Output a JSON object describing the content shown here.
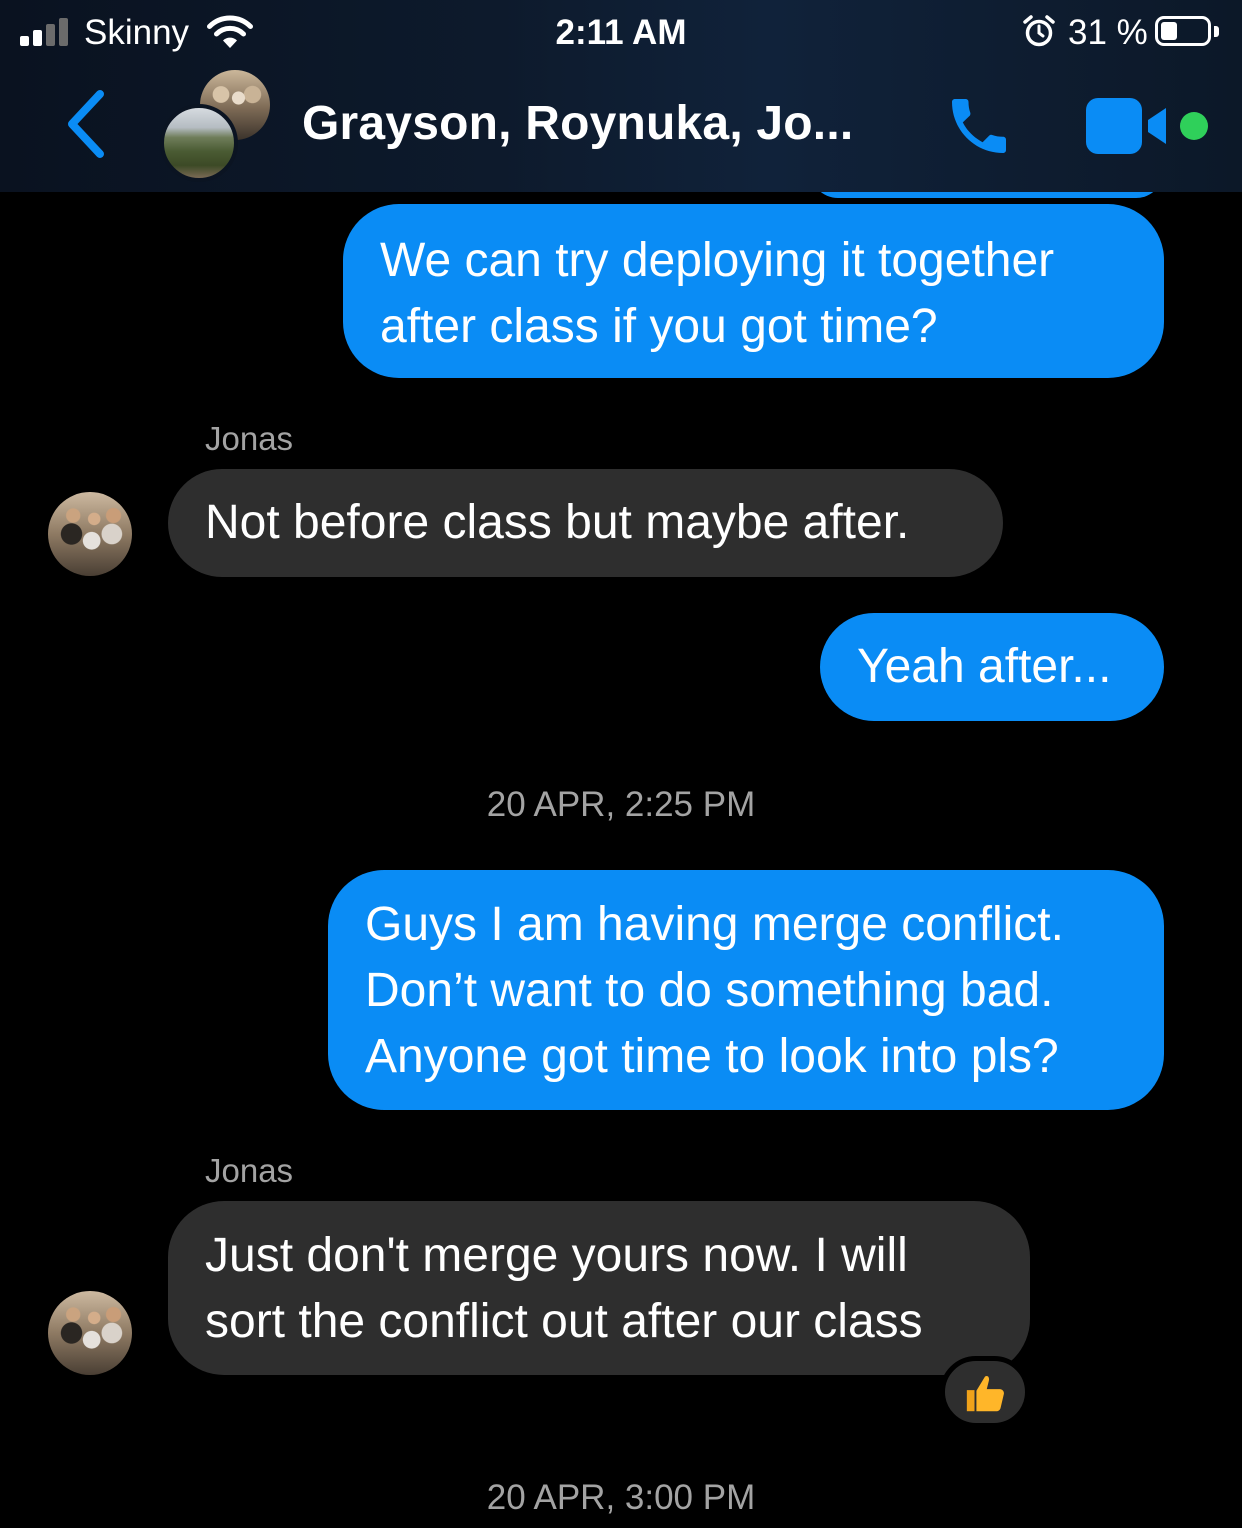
{
  "status_bar": {
    "carrier": "Skinny",
    "time": "2:11 AM",
    "battery_percent": "31 %",
    "battery_level": 0.31
  },
  "header": {
    "title": "Grayson, Roynuka, Jo...",
    "accent_color": "#0a8cf5",
    "online_color": "#2fd05a"
  },
  "messages": [
    {
      "direction": "outgoing",
      "text": "We can try deploying it together\nafter class if you got time?"
    },
    {
      "direction": "incoming",
      "sender": "Jonas",
      "text": "Not before class but maybe after."
    },
    {
      "direction": "outgoing",
      "text": "Yeah after..."
    },
    {
      "type": "timestamp",
      "text": "20 APR, 2:25 PM"
    },
    {
      "direction": "outgoing",
      "text": "Guys I am having merge conflict.\nDon’t want to do something bad.\nAnyone got time to look into pls?"
    },
    {
      "direction": "incoming",
      "sender": "Jonas",
      "text": "Just don't merge yours now. I will\nsort the conflict out after our class",
      "reaction": "thumbs-up-icon"
    },
    {
      "type": "timestamp",
      "text": "20 APR, 3:00 PM"
    }
  ]
}
